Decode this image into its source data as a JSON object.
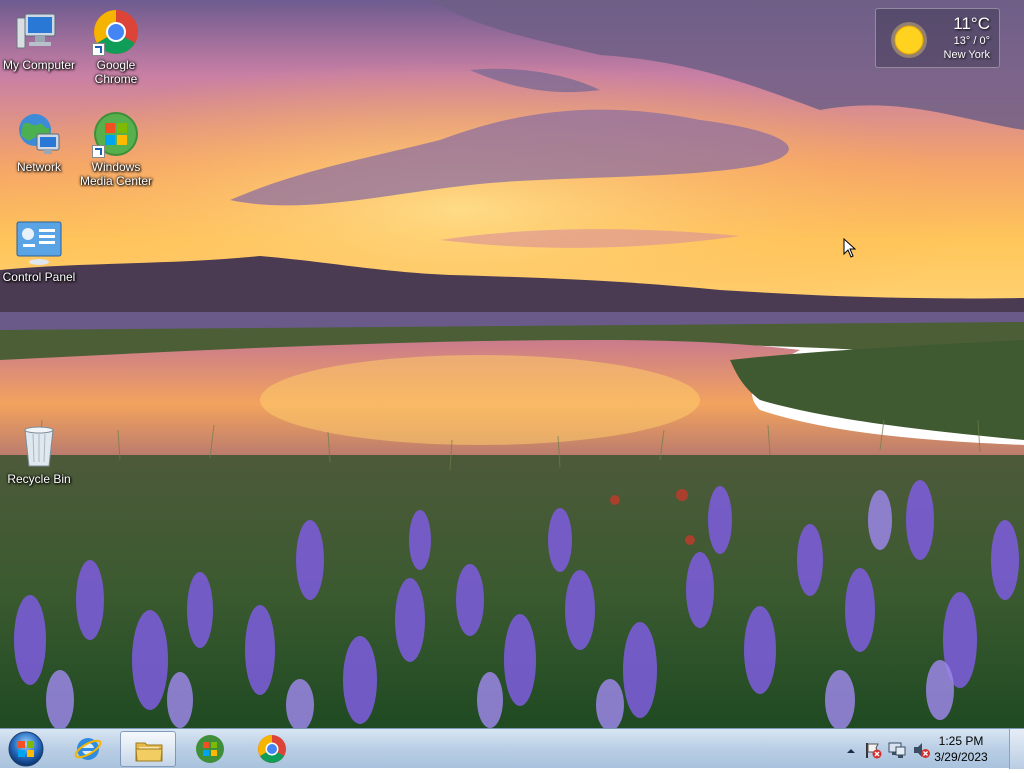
{
  "desktop": {
    "icons": [
      {
        "label": "My Computer",
        "icon": "computer-icon"
      },
      {
        "label": "Google Chrome",
        "icon": "chrome-icon"
      },
      {
        "label": "Network",
        "icon": "network-icon"
      },
      {
        "label": "Windows Media Center",
        "icon": "media-center-icon"
      },
      {
        "label": "Control Panel",
        "icon": "control-panel-icon"
      },
      {
        "label": "Recycle Bin",
        "icon": "recycle-bin-icon"
      }
    ]
  },
  "weather": {
    "temperature": "11°C",
    "range": "13° / 0°",
    "city": "New York",
    "icon": "sun-icon"
  },
  "taskbar": {
    "start_icon": "windows-start-icon",
    "pinned": [
      {
        "name": "Internet Explorer",
        "icon": "ie-icon",
        "active": false
      },
      {
        "name": "Windows Explorer",
        "icon": "folder-icon",
        "active": true
      },
      {
        "name": "Windows Media Center",
        "icon": "media-center-icon",
        "active": false
      },
      {
        "name": "Google Chrome",
        "icon": "chrome-icon",
        "active": false
      }
    ],
    "tray": {
      "icons": [
        "show-hidden-icons-arrow",
        "action-center-flag-icon",
        "network-status-icon",
        "volume-muted-icon"
      ],
      "time": "1:25 PM",
      "date": "3/29/2023"
    }
  },
  "colors": {
    "taskbar_top": "#d9e6f3",
    "taskbar_bottom": "#a9c2dd",
    "sky_gold": "#ffc44a",
    "flower_purple": "#7a5cd6"
  }
}
